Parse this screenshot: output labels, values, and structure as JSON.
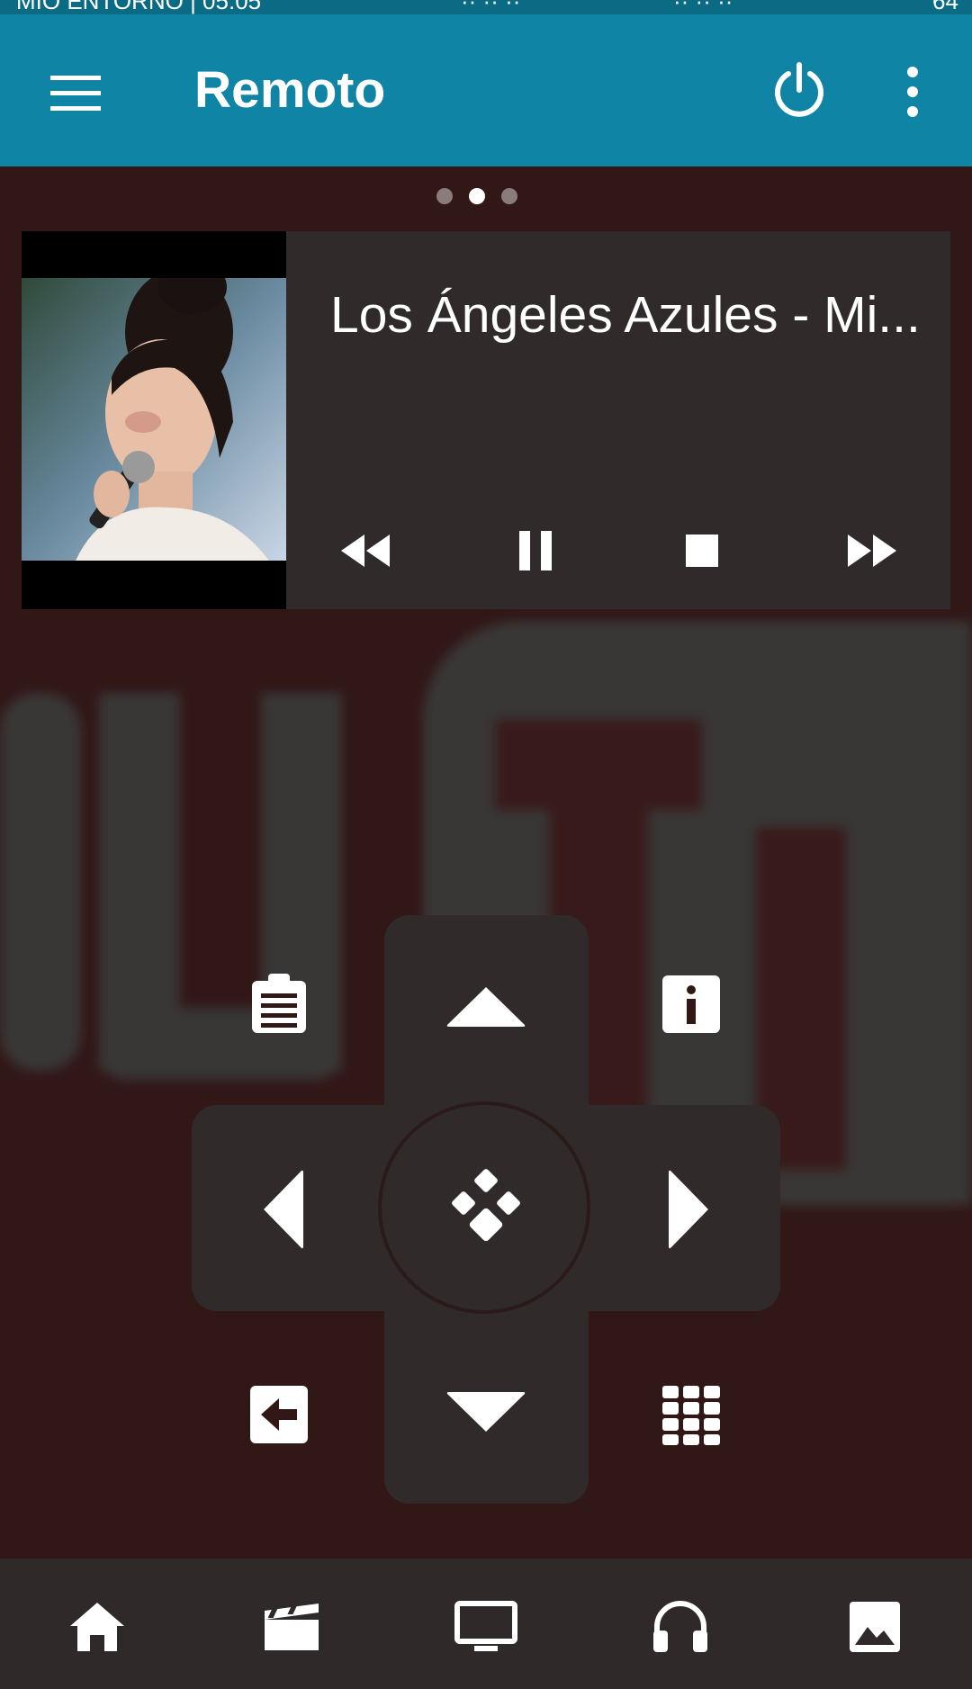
{
  "status_bar": {
    "carrier": "MIO ENTORNO | 05:05",
    "center": "·· ·· ··",
    "network": "·· ·· ··",
    "battery": "64"
  },
  "app_bar": {
    "title": "Remoto"
  },
  "pager": {
    "count": 3,
    "active_index": 1
  },
  "now_playing": {
    "title": "Los Ángeles Azules - Mi..."
  },
  "colors": {
    "app_bar": "#1084a4",
    "background": "#321717",
    "panel": "#312a2a"
  }
}
